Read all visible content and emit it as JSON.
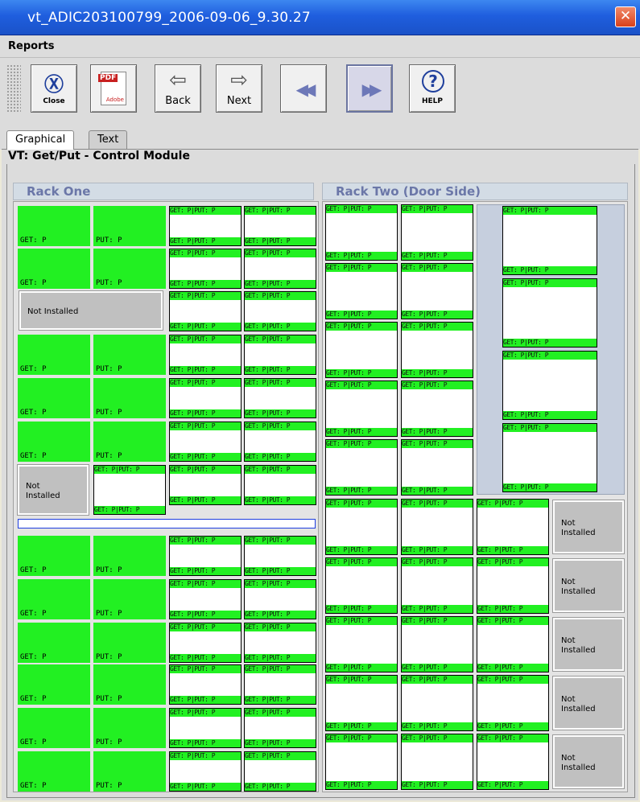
{
  "window": {
    "title": "vt_ADIC203100799_2006-09-06_9.30.27",
    "close_label": "✕"
  },
  "menu": {
    "reports": "Reports"
  },
  "toolbar": {
    "close": "Close",
    "pdf": "PDF",
    "back": "Back",
    "next": "Next",
    "first": "◀◀",
    "last": "▶▶",
    "help": "HELP",
    "close_icon": "Ⓧ",
    "back_icon": "⇦",
    "next_icon": "⇨",
    "help_icon": "?",
    "pdf_sub": "Adobe"
  },
  "tabs": {
    "graphical": "Graphical",
    "text": "Text"
  },
  "panel": {
    "title": "VT: Get/Put - Control Module"
  },
  "racks": {
    "one": "Rack One",
    "two": "Rack Two (Door Side)"
  },
  "labels": {
    "get": "GET: P",
    "put": "PUT: P",
    "pair": "GET: P|PUT: P",
    "not_installed": "Not Installed",
    "not_installed_wrapped": "Not\nInstalled"
  },
  "colors": {
    "full": "#22f022",
    "empty": "#ffffff",
    "not_installed": "#c0c0c0"
  }
}
